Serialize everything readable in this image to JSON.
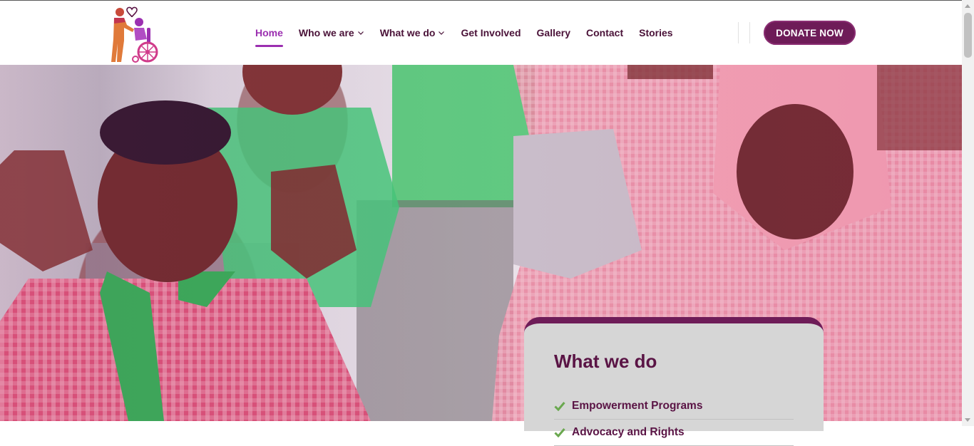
{
  "brand": {
    "logo_icon": "caregiver-wheelchair-heart-logo"
  },
  "nav": {
    "items": [
      {
        "label": "Home",
        "active": true
      },
      {
        "label": "Who we are",
        "dropdown": true
      },
      {
        "label": "What we do",
        "dropdown": true
      },
      {
        "label": "Get Involved"
      },
      {
        "label": "Gallery"
      },
      {
        "label": "Contact"
      },
      {
        "label": "Stories"
      }
    ],
    "active_color": "#9b2fb0",
    "text_color": "#4a1238"
  },
  "donate": {
    "label": "DONATE NOW",
    "color": "#6e1c58"
  },
  "hero": {
    "image": "students-smiling-in-classroom-photo"
  },
  "card": {
    "title": "What we do",
    "items": [
      "Empowerment Programs",
      "Advocacy and Rights"
    ],
    "check_color": "#6aa84f",
    "accent": "#6e1c58"
  }
}
